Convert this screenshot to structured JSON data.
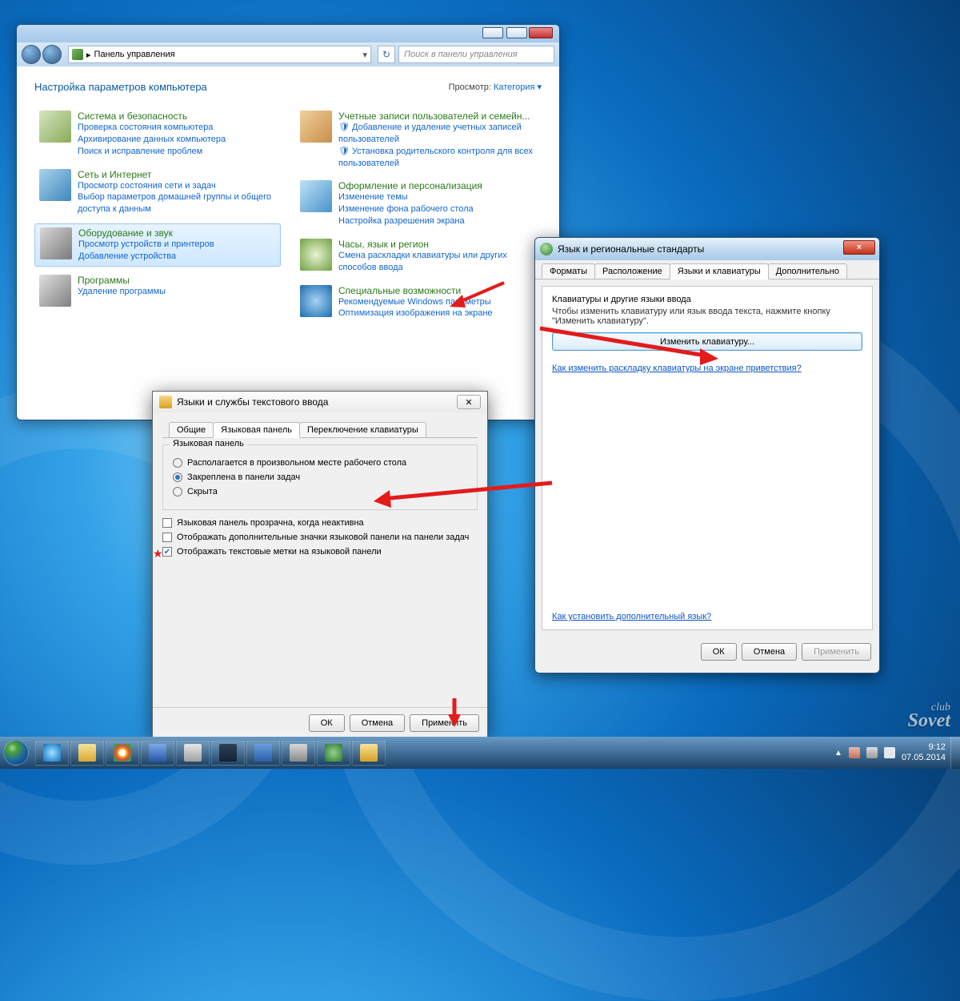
{
  "desktop": {
    "watermark_top": "club",
    "watermark_bottom": "Sovet"
  },
  "cp": {
    "address_prefix": "▸",
    "address": "Панель управления",
    "search_placeholder": "Поиск в панели управления",
    "heading": "Настройка параметров компьютера",
    "view_label": "Просмотр:",
    "view_value": "Категория ▾",
    "min_sym": "–",
    "max_sym": "▭",
    "close_sym": "×",
    "left": [
      {
        "title": "Система и безопасность",
        "icon": "ci-sys",
        "links": [
          "Проверка состояния компьютера",
          "Архивирование данных компьютера",
          "Поиск и исправление проблем"
        ]
      },
      {
        "title": "Сеть и Интернет",
        "icon": "ci-net",
        "links": [
          "Просмотр состояния сети и задач",
          "Выбор параметров домашней группы и общего доступа к данным"
        ]
      },
      {
        "title": "Оборудование и звук",
        "icon": "ci-hw",
        "sel": true,
        "links": [
          "Просмотр устройств и принтеров",
          "Добавление устройства"
        ]
      },
      {
        "title": "Программы",
        "icon": "ci-pr",
        "links": [
          "Удаление программы"
        ]
      }
    ],
    "right": [
      {
        "title": "Учетные записи пользователей и семейн...",
        "icon": "ci-usr",
        "links": [
          "🛡 Добавление и удаление учетных записей пользователей",
          "🛡 Установка родительского контроля для всех пользователей"
        ]
      },
      {
        "title": "Оформление и персонализация",
        "icon": "ci-app",
        "links": [
          "Изменение темы",
          "Изменение фона рабочего стола",
          "Настройка разрешения экрана"
        ]
      },
      {
        "title": "Часы, язык и регион",
        "icon": "ci-clk",
        "links": [
          "Смена раскладки клавиатуры или других способов ввода"
        ]
      },
      {
        "title": "Специальные возможности",
        "icon": "ci-eas",
        "links": [
          "Рекомендуемые Windows параметры",
          "Оптимизация изображения на экране"
        ]
      }
    ]
  },
  "rg": {
    "title": "Язык и региональные стандарты",
    "close_sym": "×",
    "tabs": [
      "Форматы",
      "Расположение",
      "Языки и клавиатуры",
      "Дополнительно"
    ],
    "active_tab": 2,
    "hd": "Клавиатуры и другие языки ввода",
    "text": "Чтобы изменить клавиатуру или язык ввода текста, нажмите кнопку \"Изменить клавиатуру\".",
    "button": "Изменить клавиатуру...",
    "link1": "Как изменить раскладку клавиатуры на экране приветствия?",
    "link2": "Как установить дополнительный язык?",
    "ok": "ОК",
    "cancel": "Отмена",
    "apply": "Применить"
  },
  "ts": {
    "title": "Языки и службы текстового ввода",
    "close_sym": "✕",
    "tabs": [
      "Общие",
      "Языковая панель",
      "Переключение клавиатуры"
    ],
    "active_tab": 1,
    "group": "Языковая панель",
    "radios": [
      {
        "label": "Располагается в произвольном месте рабочего стола",
        "checked": false
      },
      {
        "label": "Закреплена в панели задач",
        "checked": true
      },
      {
        "label": "Скрыта",
        "checked": false
      }
    ],
    "checks": [
      {
        "label": "Языковая панель прозрачна, когда неактивна",
        "checked": false,
        "star": false
      },
      {
        "label": "Отображать дополнительные значки языковой панели на панели задач",
        "checked": false,
        "star": false
      },
      {
        "label": "Отображать текстовые метки на языковой панели",
        "checked": true,
        "star": true
      }
    ],
    "ok": "ОК",
    "cancel": "Отмена",
    "apply": "Применить"
  },
  "taskbar": {
    "buttons": [
      "ie",
      "exp",
      "chr",
      "sv",
      "snd",
      "ps",
      "wr",
      "kb",
      "gl",
      "yel"
    ],
    "clock_time": "9:12",
    "clock_date": "07.05.2014"
  }
}
